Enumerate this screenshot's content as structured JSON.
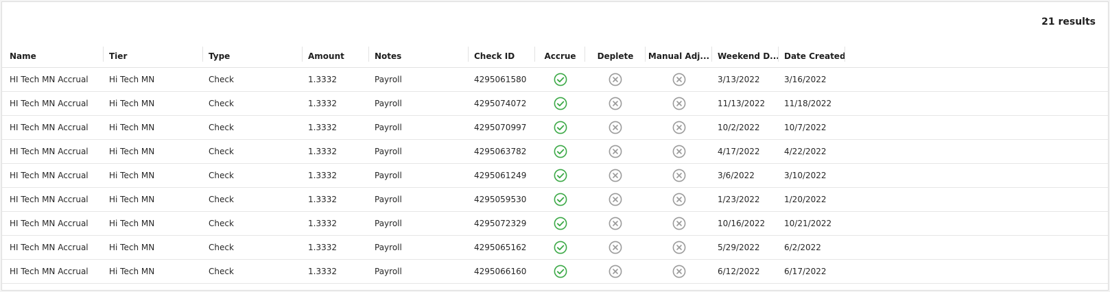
{
  "results": {
    "count_label": "21 results"
  },
  "colors": {
    "accrue_check": "#3aa845",
    "disabled_x": "#9a9a9a"
  },
  "columns": [
    {
      "key": "name",
      "label": "Name"
    },
    {
      "key": "tier",
      "label": "Tier"
    },
    {
      "key": "type",
      "label": "Type"
    },
    {
      "key": "amount",
      "label": "Amount"
    },
    {
      "key": "notes",
      "label": "Notes"
    },
    {
      "key": "check_id",
      "label": "Check ID"
    },
    {
      "key": "accrue",
      "label": "Accrue"
    },
    {
      "key": "deplete",
      "label": "Deplete"
    },
    {
      "key": "manual_adj",
      "label": "Manual Adj..."
    },
    {
      "key": "weekend_date",
      "label": "Weekend D..."
    },
    {
      "key": "date_created",
      "label": "Date Created"
    }
  ],
  "rows": [
    {
      "name": "HI Tech MN Accrual",
      "tier": "Hi Tech MN",
      "type": "Check",
      "amount": "1.3332",
      "notes": "Payroll",
      "check_id": "4295061580",
      "accrue_icon": "check-circle-icon",
      "deplete_icon": "x-circle-icon",
      "manual_adj_icon": "x-circle-icon",
      "weekend_date": "3/13/2022",
      "date_created": "3/16/2022"
    },
    {
      "name": "HI Tech MN Accrual",
      "tier": "Hi Tech MN",
      "type": "Check",
      "amount": "1.3332",
      "notes": "Payroll",
      "check_id": "4295074072",
      "accrue_icon": "check-circle-icon",
      "deplete_icon": "x-circle-icon",
      "manual_adj_icon": "x-circle-icon",
      "weekend_date": "11/13/2022",
      "date_created": "11/18/2022"
    },
    {
      "name": "HI Tech MN Accrual",
      "tier": "Hi Tech MN",
      "type": "Check",
      "amount": "1.3332",
      "notes": "Payroll",
      "check_id": "4295070997",
      "accrue_icon": "check-circle-icon",
      "deplete_icon": "x-circle-icon",
      "manual_adj_icon": "x-circle-icon",
      "weekend_date": "10/2/2022",
      "date_created": "10/7/2022"
    },
    {
      "name": "HI Tech MN Accrual",
      "tier": "Hi Tech MN",
      "type": "Check",
      "amount": "1.3332",
      "notes": "Payroll",
      "check_id": "4295063782",
      "accrue_icon": "check-circle-icon",
      "deplete_icon": "x-circle-icon",
      "manual_adj_icon": "x-circle-icon",
      "weekend_date": "4/17/2022",
      "date_created": "4/22/2022"
    },
    {
      "name": "HI Tech MN Accrual",
      "tier": "Hi Tech MN",
      "type": "Check",
      "amount": "1.3332",
      "notes": "Payroll",
      "check_id": "4295061249",
      "accrue_icon": "check-circle-icon",
      "deplete_icon": "x-circle-icon",
      "manual_adj_icon": "x-circle-icon",
      "weekend_date": "3/6/2022",
      "date_created": "3/10/2022"
    },
    {
      "name": "HI Tech MN Accrual",
      "tier": "Hi Tech MN",
      "type": "Check",
      "amount": "1.3332",
      "notes": "Payroll",
      "check_id": "4295059530",
      "accrue_icon": "check-circle-icon",
      "deplete_icon": "x-circle-icon",
      "manual_adj_icon": "x-circle-icon",
      "weekend_date": "1/23/2022",
      "date_created": "1/20/2022"
    },
    {
      "name": "HI Tech MN Accrual",
      "tier": "Hi Tech MN",
      "type": "Check",
      "amount": "1.3332",
      "notes": "Payroll",
      "check_id": "4295072329",
      "accrue_icon": "check-circle-icon",
      "deplete_icon": "x-circle-icon",
      "manual_adj_icon": "x-circle-icon",
      "weekend_date": "10/16/2022",
      "date_created": "10/21/2022"
    },
    {
      "name": "HI Tech MN Accrual",
      "tier": "Hi Tech MN",
      "type": "Check",
      "amount": "1.3332",
      "notes": "Payroll",
      "check_id": "4295065162",
      "accrue_icon": "check-circle-icon",
      "deplete_icon": "x-circle-icon",
      "manual_adj_icon": "x-circle-icon",
      "weekend_date": "5/29/2022",
      "date_created": "6/2/2022"
    },
    {
      "name": "HI Tech MN Accrual",
      "tier": "Hi Tech MN",
      "type": "Check",
      "amount": "1.3332",
      "notes": "Payroll",
      "check_id": "4295066160",
      "accrue_icon": "check-circle-icon",
      "deplete_icon": "x-circle-icon",
      "manual_adj_icon": "x-circle-icon",
      "weekend_date": "6/12/2022",
      "date_created": "6/17/2022"
    }
  ]
}
